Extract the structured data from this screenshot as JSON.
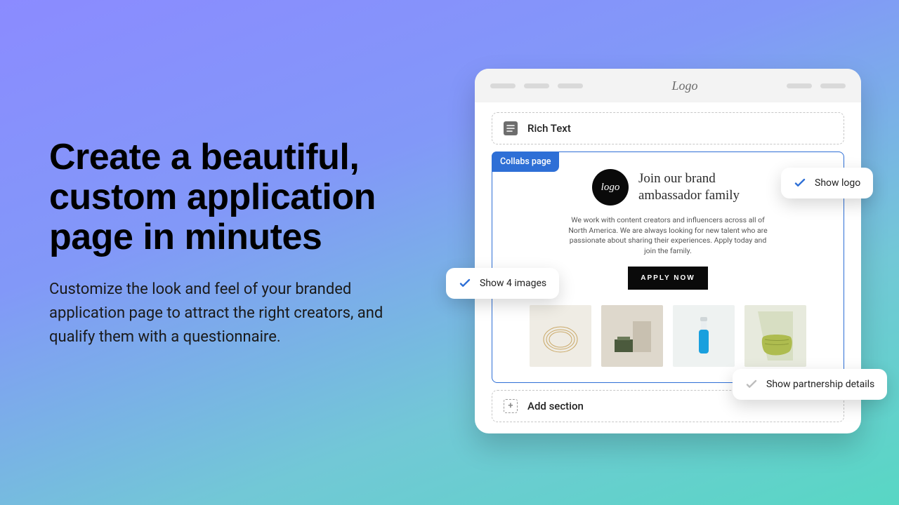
{
  "copy": {
    "title": "Create a beautiful, custom application page in minutes",
    "body": "Customize the look and feel of your branded application page to attract the right creators, and qualify them with a questionnaire."
  },
  "editor": {
    "logo_text": "Logo",
    "rich_text_label": "Rich Text",
    "collabs_tag": "Collabs page",
    "brand_logo_text": "logo",
    "brand_title": "Join our brand ambassador family",
    "blurb": "We work with content creators and influencers across all of North America. We are always looking for new talent who are passionate about sharing their experiences. Apply today and join the family.",
    "apply_label": "APPLY NOW",
    "add_section_label": "Add section"
  },
  "chips": {
    "show_logo": "Show logo",
    "show_images": "Show 4 images",
    "show_partnership": "Show partnership details"
  }
}
